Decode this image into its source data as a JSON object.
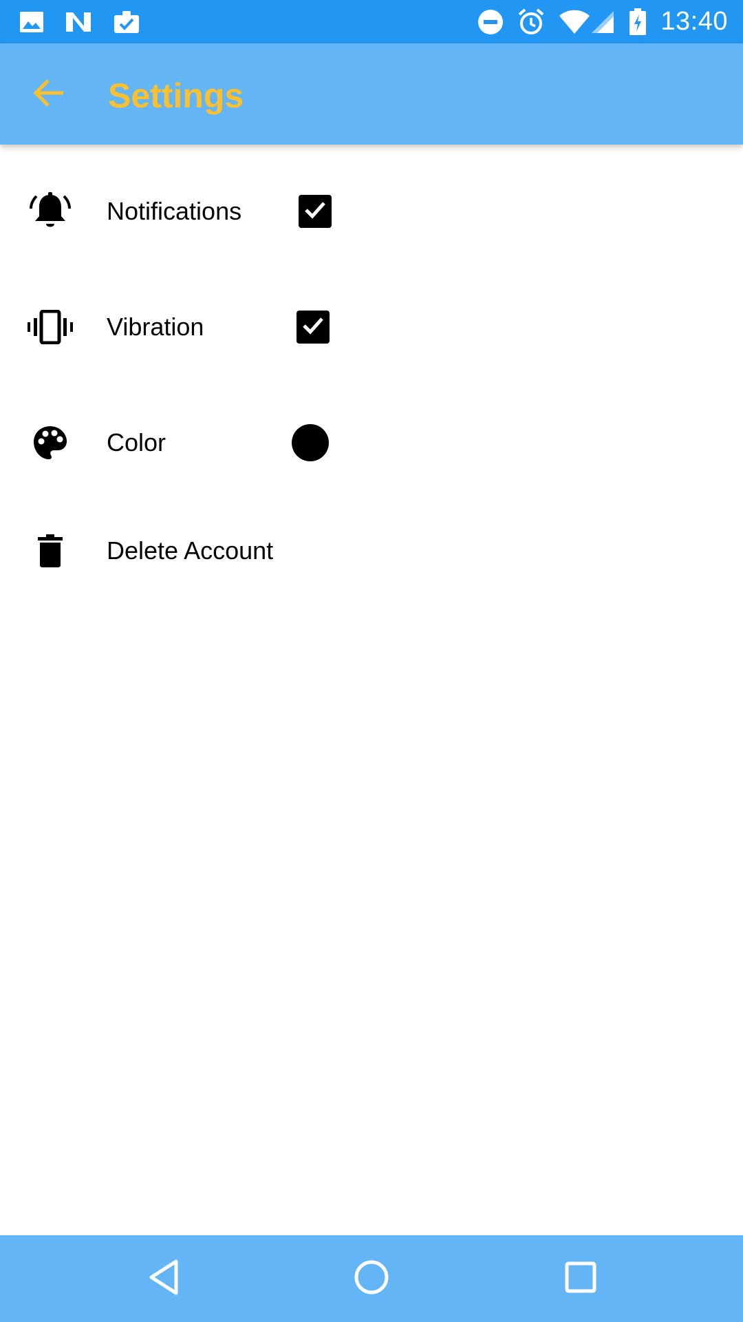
{
  "status_bar": {
    "time": "13:40",
    "left_icons": [
      "image-icon",
      "n-logo-icon",
      "clipboard-check-icon"
    ],
    "right_icons": [
      "do-not-disturb-icon",
      "alarm-icon",
      "wifi-icon",
      "cellular-signal-icon",
      "battery-charging-icon"
    ]
  },
  "app_bar": {
    "title": "Settings",
    "back_icon": "arrow-left-icon",
    "background": "#64B5F6",
    "title_color": "#FBC02D"
  },
  "settings": [
    {
      "icon": "bell-ringing-icon",
      "label": "Notifications",
      "control": "checkbox",
      "checked": true
    },
    {
      "icon": "vibrate-icon",
      "label": "Vibration",
      "control": "checkbox",
      "checked": true
    },
    {
      "icon": "palette-icon",
      "label": "Color",
      "control": "color-swatch",
      "color": "#000000"
    },
    {
      "icon": "trash-icon",
      "label": "Delete Account",
      "control": "none"
    }
  ],
  "nav_bar": {
    "buttons": [
      "back-triangle-icon",
      "home-circle-icon",
      "recents-square-icon"
    ]
  }
}
